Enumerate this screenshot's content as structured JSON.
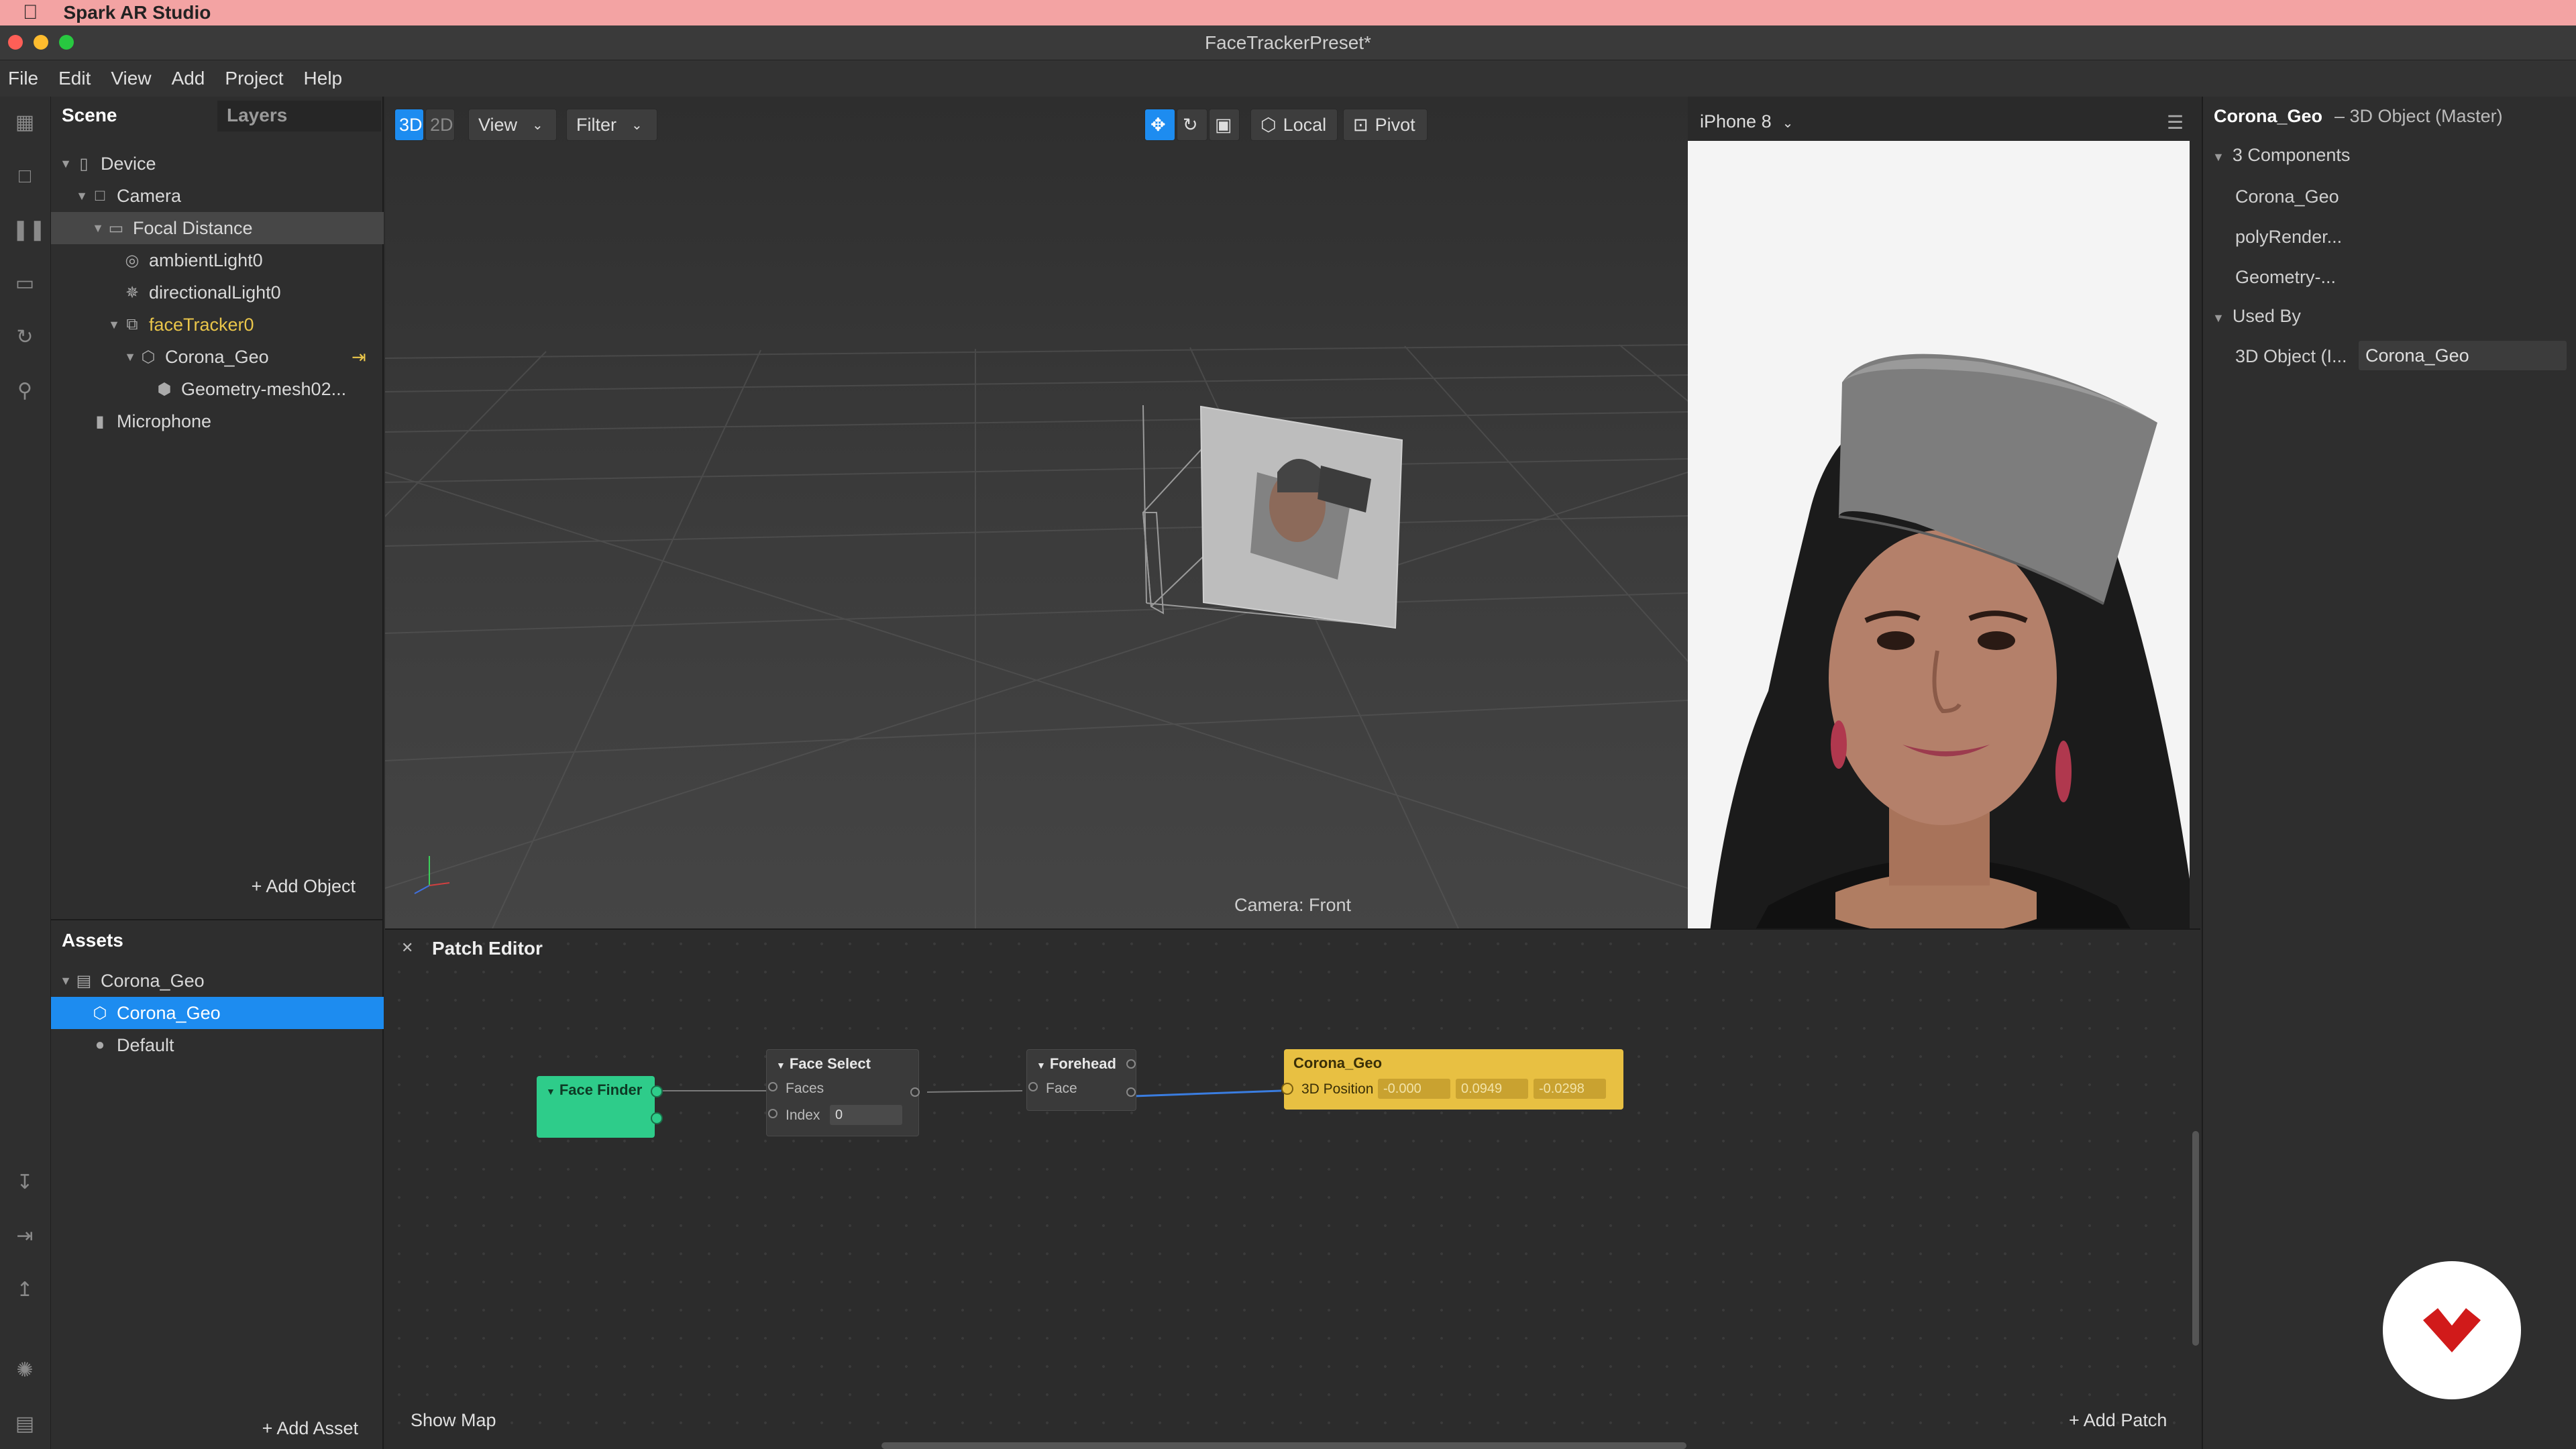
{
  "menubar": {
    "app_name": "Spark AR Studio"
  },
  "window": {
    "title": "FaceTrackerPreset*"
  },
  "app_menu": [
    "File",
    "Edit",
    "View",
    "Add",
    "Project",
    "Help"
  ],
  "scene_panel": {
    "tabs": [
      "Scene",
      "Layers"
    ],
    "tree": [
      {
        "label": "Device",
        "icon": "phone-icon",
        "depth": 0,
        "caret": true
      },
      {
        "label": "Camera",
        "icon": "camera-icon",
        "depth": 1,
        "caret": true
      },
      {
        "label": "Focal Distance",
        "icon": "focal-plane-icon",
        "depth": 2,
        "caret": true,
        "highlight": true
      },
      {
        "label": "ambientLight0",
        "icon": "ambient-light-icon",
        "depth": 3,
        "caret": false
      },
      {
        "label": "directionalLight0",
        "icon": "directional-light-icon",
        "depth": 3,
        "caret": false
      },
      {
        "label": "faceTracker0",
        "icon": "face-tracker-icon",
        "depth": 3,
        "caret": true,
        "accent": true
      },
      {
        "label": "Corona_Geo",
        "icon": "3d-object-icon",
        "depth": 4,
        "caret": true
      },
      {
        "label": "Geometry-mesh02...",
        "icon": "mesh-icon",
        "depth": 5,
        "caret": false
      },
      {
        "label": "Microphone",
        "icon": "microphone-icon",
        "depth": 1,
        "caret": false
      }
    ],
    "add_object": "Add Object"
  },
  "assets_panel": {
    "title": "Assets",
    "tree": [
      {
        "label": "Corona_Geo",
        "icon": "file-icon",
        "depth": 0,
        "caret": true
      },
      {
        "label": "Corona_Geo",
        "icon": "3d-object-icon",
        "depth": 1,
        "caret": false,
        "selected": true
      },
      {
        "label": "Default",
        "icon": "material-sphere-icon",
        "depth": 1,
        "caret": false
      }
    ],
    "add_asset": "Add Asset"
  },
  "viewport": {
    "mode_3d": "3D",
    "mode_2d": "2D",
    "view": "View",
    "filter": "Filter",
    "local": "Local",
    "pivot": "Pivot",
    "camera_label": "Camera: Front"
  },
  "simulator": {
    "device": "iPhone 8"
  },
  "inspector": {
    "object_name": "Corona_Geo",
    "object_type": "– 3D Object (Master)",
    "components_header": "3 Components",
    "components": [
      "Corona_Geo",
      "polyRender...",
      "Geometry-..."
    ],
    "used_by_header": "Used By",
    "used_by_label": "3D Object (I...",
    "used_by_value": "Corona_Geo"
  },
  "patch_editor": {
    "title": "Patch Editor",
    "show_map": "Show Map",
    "add_patch": "Add Patch",
    "face_finder": {
      "title": "Face Finder"
    },
    "face_select": {
      "title": "Face Select",
      "input_faces": "Faces",
      "input_index": "Index",
      "index_value": "0"
    },
    "forehead": {
      "title": "Forehead",
      "input_face": "Face"
    },
    "corona_geo": {
      "title": "Corona_Geo",
      "input": "3D Position",
      "x": "-0.000",
      "y": "0.0949",
      "z": "-0.0298"
    }
  },
  "colors": {
    "accent_blue": "#1d8cf0",
    "face_finder_green": "#2ecc8a",
    "object_patch_yellow": "#e8c042",
    "face_tracker_label": "#e9c54a"
  }
}
